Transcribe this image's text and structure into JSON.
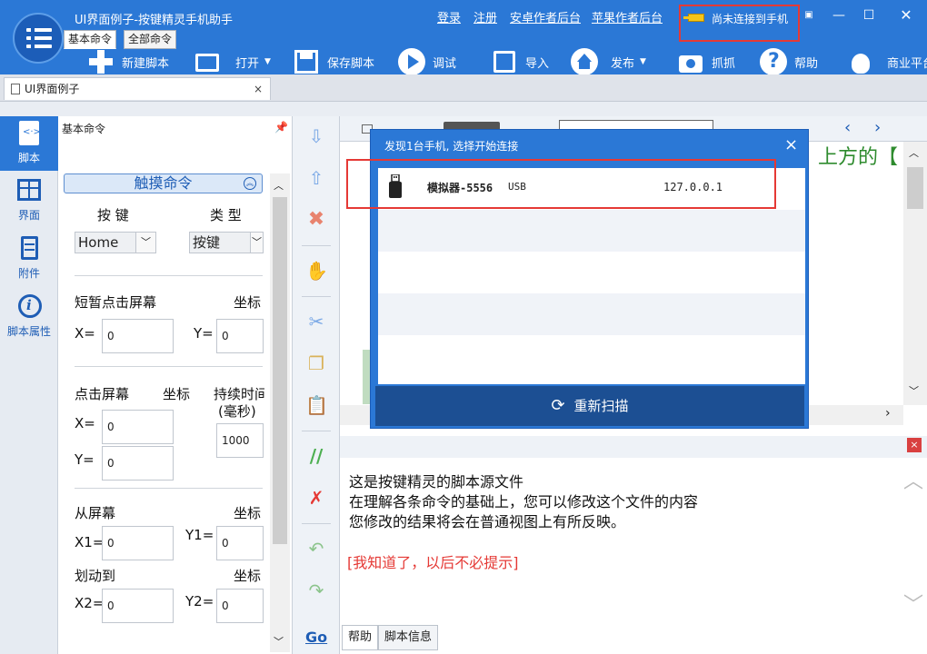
{
  "app": {
    "title": "UI界面例子-按键精灵手机助手"
  },
  "top_links": [
    "登录",
    "注册",
    "安卓作者后台",
    "苹果作者后台"
  ],
  "connection": {
    "status": "尚未连接到手机"
  },
  "toolbar": {
    "new": "新建脚本",
    "open": "打开",
    "save": "保存脚本",
    "debug": "调试",
    "import": "导入",
    "publish": "发布",
    "capture": "抓抓",
    "help": "帮助",
    "business": "商业平台"
  },
  "doc_tab": {
    "label": "UI界面例子"
  },
  "nav": [
    {
      "label": "脚本"
    },
    {
      "label": "界面"
    },
    {
      "label": "附件"
    },
    {
      "label": "脚本属性"
    }
  ],
  "panel": {
    "title": "基本命令",
    "tabs": [
      "基本命令",
      "全部命令"
    ],
    "category": "触摸命令",
    "key_label": "按 键",
    "type_label": "类 型",
    "key_value": "Home",
    "type_value": "按键",
    "short_tap": "短暂点击屏幕",
    "coords": "坐标",
    "x_label": "X=",
    "y_label": "Y=",
    "x_value": "0",
    "y_value": "0",
    "tap": "点击屏幕",
    "duration": "持续时间",
    "ms": "(毫秒)",
    "duration_value": "1000",
    "from_screen": "从屏幕",
    "x1": "X1=",
    "y1": "Y1=",
    "swipe_to": "划动到",
    "x2": "X2=",
    "y2": "Y2="
  },
  "editor": {
    "green_text": "上方的【"
  },
  "help": {
    "line1": "这是按键精灵的脚本源文件",
    "line2": "在理解各条命令的基础上，您可以修改这个文件的内容",
    "line3": "您修改的结果将会在普通视图上有所反映。",
    "link": "[我知道了，以后不必提示]"
  },
  "bottom_tabs": [
    "帮助",
    "脚本信息"
  ],
  "dialog": {
    "title": "发现1台手机, 选择开始连接",
    "device": {
      "name": "模拟器-5556",
      "connection": "USB",
      "ip": "127.0.0.1"
    },
    "rescan": "重新扫描"
  },
  "colors": {
    "primary": "#2b78d6",
    "dark": "#1c4f93",
    "highlight": "#e53935",
    "green": "#2e8b2e"
  }
}
